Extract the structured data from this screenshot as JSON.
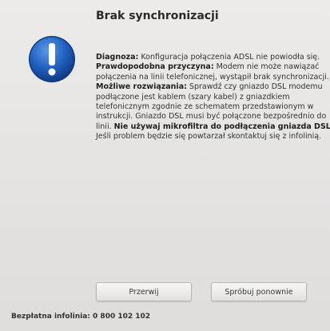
{
  "dialog": {
    "title": "Brak synchronizacji",
    "icon": "info-icon",
    "accent_color": "#1f5fbf",
    "diagnosis_label": "Diagnoza:",
    "diagnosis_text": " Konfiguracja połączenia ADSL nie powiodła się.",
    "cause_label": "Prawdopodobna przyczyna:",
    "cause_text": " Modem nie może nawiązać połączenia na linii telefonicznej, wystąpił brak synchronizacji.",
    "solution_label": "Możliwe rozwiązania:",
    "solution_text_1": " Sprawdź czy gniazdo DSL modemu podłączone jest kablem (szary kabel) z gniazdkiem telefonicznym zgodnie ze schematem przedstawionym w instrukcji. Gniazdo DSL musi być połączone bezpośrednio do linii. ",
    "solution_bold": "Nie używaj mikrofiltra do podłączenia gniazda DSL.",
    "solution_text_2": " Jeśli problem będzie się powtarzał skontaktuj się z infolinią."
  },
  "buttons": {
    "skip_label": "Przerwij",
    "retry_label": "Spróbuj ponownie"
  },
  "footer": {
    "helpline": "Bezpłatna infolinia: 0 800 102 102"
  }
}
